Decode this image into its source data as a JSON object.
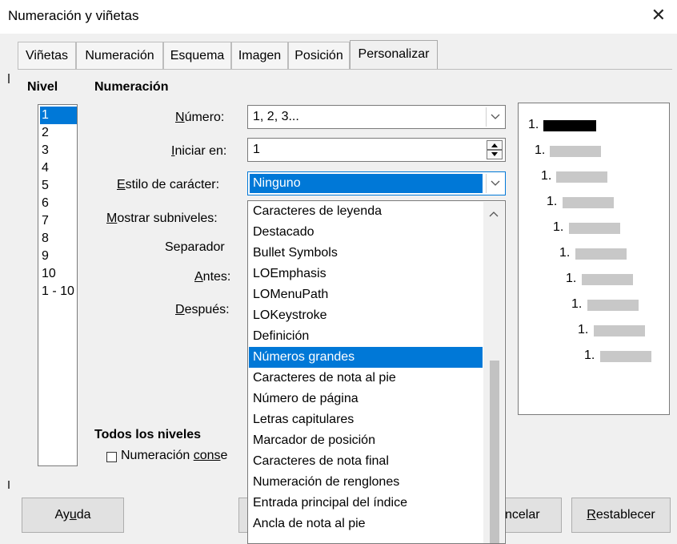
{
  "window": {
    "title": "Numeración y viñetas",
    "close_glyph": "✕"
  },
  "tabs": [
    {
      "label": "Viñetas"
    },
    {
      "label": "Numeración"
    },
    {
      "label": "Esquema"
    },
    {
      "label": "Imagen"
    },
    {
      "label": "Posición"
    },
    {
      "label": "Personalizar",
      "active": true
    }
  ],
  "levels": {
    "header": "Nivel",
    "items": [
      "1",
      "2",
      "3",
      "4",
      "5",
      "6",
      "7",
      "8",
      "9",
      "10",
      "1 - 10"
    ],
    "selected_index": 0
  },
  "numbering": {
    "header": "Numeración",
    "numero_label_pre": "",
    "numero_label_u": "N",
    "numero_label_post": "úmero:",
    "numero_value": "1, 2, 3...",
    "iniciar_label_pre": "",
    "iniciar_label_u": "I",
    "iniciar_label_post": "niciar en:",
    "iniciar_value": "1",
    "estilo_label_pre": "",
    "estilo_label_u": "E",
    "estilo_label_post": "stilo de carácter:",
    "estilo_value": "Ninguno",
    "subniveles_label_pre": "",
    "subniveles_label_u": "M",
    "subniveles_label_post": "ostrar subniveles:",
    "separador_label": "Separador",
    "antes_label_pre": "",
    "antes_label_u": "A",
    "antes_label_post": "ntes:",
    "despues_label_pre": "",
    "despues_label_u": "D",
    "despues_label_post": "espués:"
  },
  "all_levels": {
    "header": "Todos los niveles",
    "checkbox_label_pre": "Numeración ",
    "checkbox_label_u": "cons",
    "checkbox_label_post": "e",
    "checked": false
  },
  "dropdown": {
    "items": [
      "Caracteres de leyenda",
      "Destacado",
      "Bullet Symbols",
      "LOEmphasis",
      "LOMenuPath",
      "LOKeystroke",
      "Definición",
      "Números grandes",
      "Caracteres de nota al pie",
      "Número de página",
      "Letras capitulares",
      "Marcador de posición",
      "Caracteres de nota final",
      "Numeración de renglones",
      "Entrada principal del índice",
      "Ancla de nota al pie"
    ],
    "highlighted_index": 7
  },
  "preview": {
    "items": [
      "1.",
      "1.",
      "1.",
      "1.",
      "1.",
      "1.",
      "1.",
      "1.",
      "1.",
      "1."
    ]
  },
  "buttons": {
    "help_pre": "Ay",
    "help_u": "u",
    "help_post": "da",
    "cancel_partial": "ncelar",
    "reset_pre": "",
    "reset_u": "R",
    "reset_post": "establecer"
  },
  "colors": {
    "accent": "#0078d7",
    "panel": "#f0f0f0"
  }
}
